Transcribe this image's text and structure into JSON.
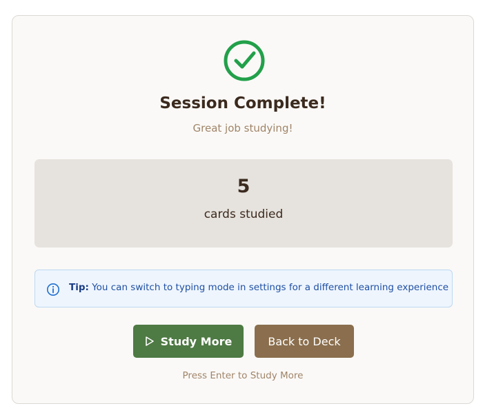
{
  "session": {
    "title": "Session Complete!",
    "subtitle": "Great job studying!"
  },
  "stats": {
    "count": "5",
    "label": "cards studied"
  },
  "tip": {
    "prefix": "Tip:",
    "text": " You can switch to typing mode in settings for a different learning experience"
  },
  "actions": {
    "study_more_label": "Study More",
    "back_label": "Back to Deck",
    "hint": "Press Enter to Study More"
  },
  "icons": {
    "success": "check-circle-icon",
    "info": "info-icon",
    "play": "play-icon"
  },
  "colors": {
    "success": "#22a04a",
    "primary_button": "#4e7a43",
    "secondary_button": "#8a6e4d",
    "tip_text": "#1f4fa3"
  }
}
